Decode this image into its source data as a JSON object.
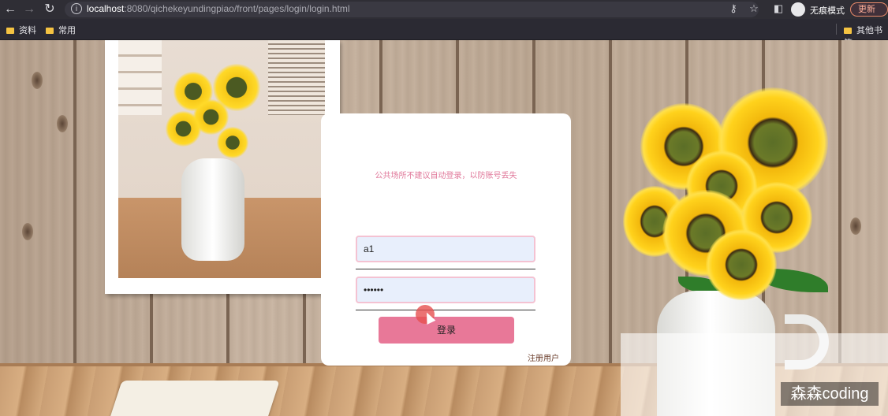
{
  "browser": {
    "url_host": "localhost",
    "url_path": ":8080/qichekeyundingpiao/front/pages/login/login.html",
    "incognito_label": "无痕模式",
    "update_label": "更新",
    "bookmarks": [
      "资料",
      "常用"
    ],
    "other_bookmarks": "其他书签",
    "icons": [
      "back-icon",
      "forward-icon",
      "reload-icon",
      "info-icon",
      "key-icon",
      "star-icon",
      "sidebar-icon",
      "incognito-icon"
    ]
  },
  "login": {
    "tip": "公共场所不建议自动登录，以防账号丢失",
    "username_value": "a1",
    "password_value": "123456",
    "login_label": "登录",
    "register_label": "注册用户"
  },
  "watermark": "森森coding",
  "colors": {
    "accent_button": "#e87898",
    "tip_text": "#e0789a",
    "input_border": "#f4c2d2",
    "input_bg": "#e8effc"
  }
}
